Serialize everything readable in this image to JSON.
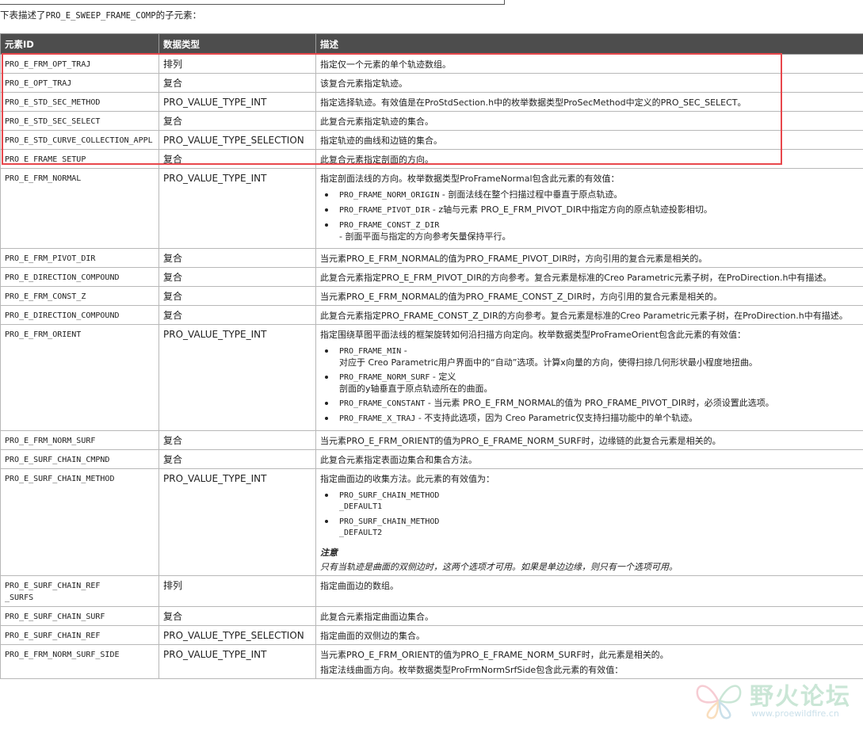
{
  "intro": {
    "prefix": "下表描述了",
    "code": "PRO_E_SWEEP_FRAME_COMP",
    "suffix": "的子元素："
  },
  "table": {
    "headers": [
      "元素ID",
      "数据类型",
      "描述"
    ],
    "rows": [
      {
        "id": "PRO_E_FRM_OPT_TRAJ",
        "type": "排列",
        "desc": "指定仅一个元素的单个轨迹数组。"
      },
      {
        "id": "PRO_E_OPT_TRAJ",
        "type": "复合",
        "desc": "该复合元素指定轨迹。"
      },
      {
        "id": "PRO_E_STD_SEC_METHOD",
        "type": "PRO_VALUE_TYPE_INT",
        "desc": "指定选择轨迹。有效值是在ProStdSection.h中的枚举数据类型ProSecMethod中定义的PRO_SEC_SELECT。"
      },
      {
        "id": "PRO_E_STD_SEC_SELECT",
        "type": "复合",
        "desc": "此复合元素指定轨迹的集合。"
      },
      {
        "id": "PRO_E_STD_CURVE_COLLECTION_APPL",
        "type": "PRO_VALUE_TYPE_SELECTION",
        "desc": "指定轨迹的曲线和边链的集合。"
      },
      {
        "id": "PRO_E_FRAME_SETUP",
        "type": "复合",
        "desc": "此复合元素指定剖面的方向。"
      },
      {
        "id": "PRO_E_FRM_NORMAL",
        "type": "PRO_VALUE_TYPE_INT",
        "desc": "指定剖面法线的方向。枚举数据类型ProFrameNormal包含此元素的有效值：",
        "items": [
          {
            "code": "PRO_FRAME_NORM_ORIGIN",
            "text": " - 剖面法线在整个扫描过程中垂直于原点轨迹。"
          },
          {
            "code": "PRO_FRAME_PIVOT_DIR",
            "text": " - z轴与元素 PRO_E_FRM_PIVOT_DIR中指定方向的原点轨迹投影相切。"
          },
          {
            "code": "PRO_FRAME_CONST_Z_DIR",
            "line2": "- 剖面平面与指定的方向参考矢量保持平行。"
          }
        ]
      },
      {
        "id": "PRO_E_FRM_PIVOT_DIR",
        "type": "复合",
        "desc": "当元素PRO_E_FRM_NORMAL的值为PRO_FRAME_PIVOT_DIR时，方向引用的复合元素是相关的。"
      },
      {
        "id": "PRO_E_DIRECTION_COMPOUND",
        "type": "复合",
        "desc": "此复合元素指定PRO_E_FRM_PIVOT_DIR的方向参考。复合元素是标准的Creo Parametric元素子树，在ProDirection.h中有描述。"
      },
      {
        "id": "PRO_E_FRM_CONST_Z",
        "type": "复合",
        "desc": "当元素PRO_E_FRM_NORMAL的值为PRO_FRAME_CONST_Z_DIR时，方向引用的复合元素是相关的。"
      },
      {
        "id": "PRO_E_DIRECTION_COMPOUND",
        "type": "复合",
        "desc": "此复合元素指定PRO_FRAME_CONST_Z_DIR的方向参考。复合元素是标准的Creo Parametric元素子树，在ProDirection.h中有描述。"
      },
      {
        "id": "PRO_E_FRM_ORIENT",
        "type": "PRO_VALUE_TYPE_INT",
        "desc": "指定围绕草图平面法线的框架旋转如何沿扫描方向定向。枚举数据类型ProFrameOrient包含此元素的有效值：",
        "items": [
          {
            "code": "PRO_FRAME_MIN",
            "text": " -",
            "line2": "对应于 Creo Parametric用户界面中的“自动”选项。计算x向量的方向，使得扫掠几何形状最小程度地扭曲。"
          },
          {
            "code": "PRO_FRAME_NORM_SURF",
            "text": " - 定义",
            "line2": "剖面的y轴垂直于原点轨迹所在的曲面。"
          },
          {
            "code": "PRO_FRAME_CONSTANT",
            "text": " - 当元素 PRO_E_FRM_NORMAL的值为 PRO_FRAME_PIVOT_DIR时，必须设置此选项。"
          },
          {
            "code": "PRO_FRAME_X_TRAJ",
            "text": " - 不支持此选项，因为 Creo Parametric仅支持扫描功能中的单个轨迹。"
          }
        ]
      },
      {
        "id": "PRO_E_FRM_NORM_SURF",
        "type": "复合",
        "desc": "当元素PRO_E_FRM_ORIENT的值为PRO_E_FRAME_NORM_SURF时，边缘链的此复合元素是相关的。"
      },
      {
        "id": "PRO_E_SURF_CHAIN_CMPND",
        "type": "复合",
        "desc": "此复合元素指定表面边集合和集合方法。"
      },
      {
        "id": "PRO_E_SURF_CHAIN_METHOD",
        "type": "PRO_VALUE_TYPE_INT",
        "desc": "指定曲面边的收集方法。此元素的有效值为：",
        "items": [
          {
            "code": "PRO_SURF_CHAIN_METHOD",
            "line2": "_DEFAULT1"
          },
          {
            "code": "PRO_SURF_CHAIN_METHOD",
            "line2": "_DEFAULT2"
          }
        ],
        "note_title": "注意",
        "note_body": "只有当轨迹是曲面的双侧边时，这两个选项才可用。如果是单边边缘，则只有一个选项可用。"
      },
      {
        "id": "PRO_E_SURF_CHAIN_REF",
        "id2": "_SURFS",
        "type": "排列",
        "desc": "指定曲面边的数组。"
      },
      {
        "id": "PRO_E_SURF_CHAIN_SURF",
        "type": "复合",
        "desc": "此复合元素指定曲面边集合。"
      },
      {
        "id": "PRO_E_SURF_CHAIN_REF",
        "type": "PRO_VALUE_TYPE_SELECTION",
        "desc": "指定曲面的双侧边的集合。"
      },
      {
        "id": "PRO_E_FRM_NORM_SURF_SIDE",
        "type": "PRO_VALUE_TYPE_INT",
        "desc": "当元素PRO_E_FRM_ORIENT的值为PRO_E_FRAME_NORM_SURF时，此元素是相关的。",
        "desc2": "指定法线曲面方向。枚举数据类型ProFrmNormSrfSide包含此元素的有效值："
      }
    ]
  },
  "watermark": {
    "title": "野火论坛",
    "url": "www.proewildfire.cn"
  },
  "colors": {
    "header_bg": "#4d4d4d",
    "highlight": "#e8474c"
  }
}
